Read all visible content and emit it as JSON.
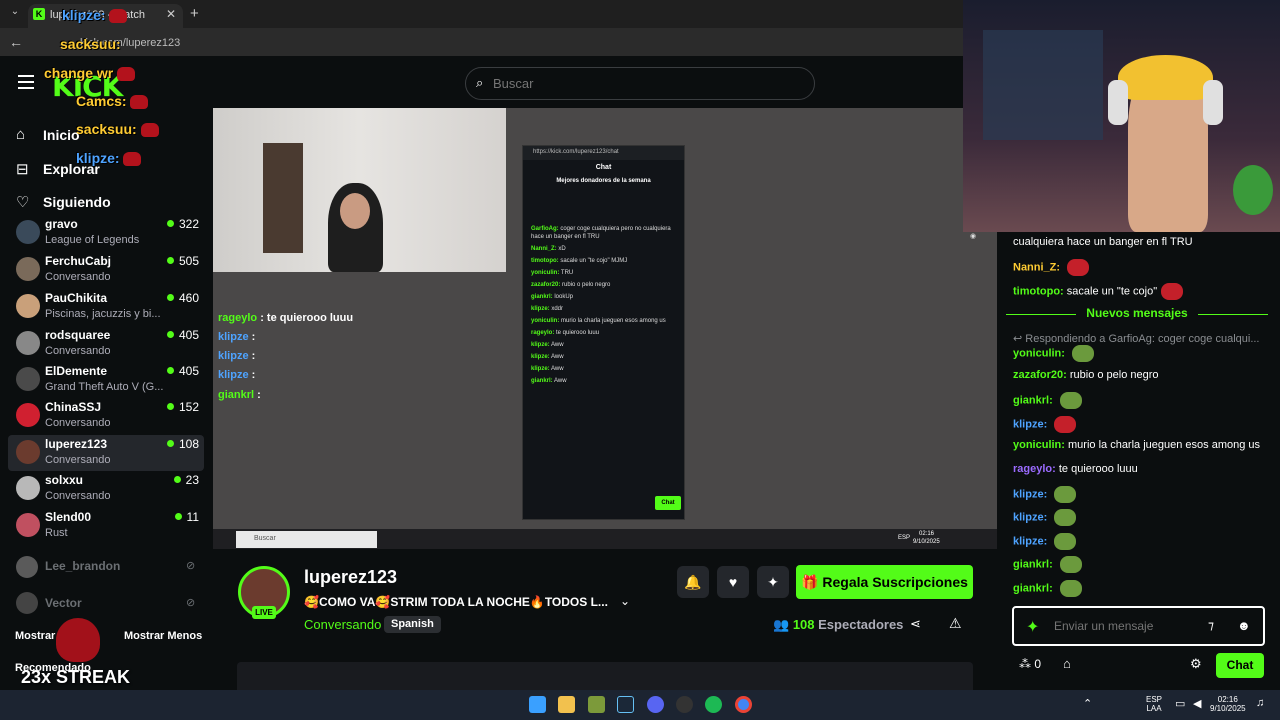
{
  "browser": {
    "tab_title": "luperez123 - Watch",
    "address": "kick.com/luperez123"
  },
  "overlay": {
    "lines": [
      {
        "user": "klipze:",
        "color": "#4ea3ff"
      },
      {
        "user": "sacksuu:",
        "color": "#ffcc33"
      },
      {
        "user": "change wr",
        "color": "#ffcc33"
      },
      {
        "user": "Camcs:",
        "color": "#ffcc33"
      },
      {
        "user": "sacksuu:",
        "color": "#ffcc33"
      },
      {
        "user": "klipze:",
        "color": "#4ea3ff"
      }
    ],
    "streak": "23x STREAK"
  },
  "header": {
    "logo": "KICK",
    "search_placeholder": "Buscar"
  },
  "sidebar": {
    "nav": [
      {
        "label": "Inicio",
        "icon": "home-icon"
      },
      {
        "label": "Explorar",
        "icon": "compass-icon"
      },
      {
        "label": "Siguiendo",
        "icon": "heart-icon"
      }
    ],
    "channels": [
      {
        "name": "gravo",
        "sub": "League of Legends",
        "count": "322",
        "avatar": "#3a4a5a"
      },
      {
        "name": "FerchuCabj",
        "sub": "Conversando",
        "count": "505",
        "avatar": "#7a6a5a"
      },
      {
        "name": "PauChikita",
        "sub": "Piscinas, jacuzzis y bi...",
        "count": "460",
        "avatar": "#c9a07a"
      },
      {
        "name": "rodsquaree",
        "sub": "Conversando",
        "count": "405",
        "avatar": "#888888"
      },
      {
        "name": "ElDemente",
        "sub": "Grand Theft Auto V (G...",
        "count": "405",
        "avatar": "#4a4a4a"
      },
      {
        "name": "ChinaSSJ",
        "sub": "Conversando",
        "count": "152",
        "avatar": "#d02030"
      },
      {
        "name": "luperez123",
        "sub": "Conversando",
        "count": "108",
        "avatar": "#6b3b2e"
      },
      {
        "name": "solxxu",
        "sub": "Conversando",
        "count": "23",
        "avatar": "#b8b8b8"
      },
      {
        "name": "Slend00",
        "sub": "Rust",
        "count": "11",
        "avatar": "#c05060"
      }
    ],
    "offline": [
      {
        "name": "Lee_brandon",
        "avatar": "#5a5a5a"
      },
      {
        "name": "Vector",
        "avatar": "#444444"
      }
    ],
    "show_more": "Mostrar",
    "show_less": "Mostrar Menos",
    "recommended": "Recomendado"
  },
  "player": {
    "chat_overlay": [
      {
        "user": "rageylo",
        "text": ": te quierooo luuu",
        "color": "#53fc18"
      },
      {
        "user": "klipze",
        "text": ":",
        "color": "#4ea3ff"
      },
      {
        "user": "klipze",
        "text": ":",
        "color": "#4ea3ff"
      },
      {
        "user": "klipze",
        "text": ":",
        "color": "#4ea3ff"
      },
      {
        "user": "giankrl",
        "text": ":",
        "color": "#53fc18"
      }
    ],
    "popup": {
      "url": "https://kick.com/luperez123/chat",
      "title": "Chat",
      "donors": "Mejores donadores de la semana",
      "lines": [
        {
          "user": "GarfioAg:",
          "text": "coger coge cualquiera pero no cualquiera hace un banger en fl TRU"
        },
        {
          "user": "Nanni_Z:",
          "text": "xD"
        },
        {
          "user": "timotopo:",
          "text": "sacale un \"te cojo\" MJMJ"
        },
        {
          "user": "yoniculin:",
          "text": "TRU"
        },
        {
          "user": "zazafor20:",
          "text": "rubio o pelo negro"
        },
        {
          "user": "giankrl:",
          "text": "lookUp"
        },
        {
          "user": "klipze:",
          "text": "xddr"
        },
        {
          "user": "yoniculin:",
          "text": "murio la charla jueguen esos among us"
        },
        {
          "user": "rageylo:",
          "text": "te quierooo luuu"
        },
        {
          "user": "klipze:",
          "text": "Aww"
        },
        {
          "user": "klipze:",
          "text": "Aww"
        },
        {
          "user": "klipze:",
          "text": "Aww"
        },
        {
          "user": "giankrl:",
          "text": "Aww"
        }
      ],
      "chat_btn": "Chat"
    },
    "taskbar_search": "Buscar",
    "clock": "02:16",
    "date": "9/10/2025",
    "lang": "ESP"
  },
  "stream": {
    "name": "luperez123",
    "title": "🥰COMO VA🥰STRIM TODA LA NOCHE🔥TODOS L...",
    "category": "Conversando",
    "language": "Spanish",
    "live": "LIVE",
    "subscribe": "Regala Suscripciones",
    "viewers_count": "108",
    "viewers_label": "Espectadores"
  },
  "chat": {
    "lines": [
      {
        "user": "",
        "text": "cualquiera hace un banger en fl TRU",
        "color": "#ffffff",
        "emote": ""
      },
      {
        "user": "Nanni_Z:",
        "text": "",
        "color": "#ffcc33",
        "emote": "red"
      },
      {
        "user": "timotopo:",
        "text": "sacale un \"te cojo\"",
        "color": "#53fc18",
        "emote": "red"
      }
    ],
    "new_messages": "Nuevos mensajes",
    "reply_hint": "Respondiendo a GarfioAg: coger coge cualqui...",
    "lines2": [
      {
        "user": "yoniculin:",
        "text": "",
        "color": "#53fc18",
        "emote": "pepe"
      },
      {
        "user": "zazafor20:",
        "text": "rubio o pelo negro",
        "color": "#53fc18",
        "emote": ""
      },
      {
        "user": "giankrl:",
        "text": "",
        "color": "#53fc18",
        "emote": "pepe"
      },
      {
        "user": "klipze:",
        "text": "",
        "color": "#4ea3ff",
        "emote": "red"
      },
      {
        "user": "yoniculin:",
        "text": "murio la charla jueguen esos among us",
        "color": "#53fc18",
        "emote": ""
      },
      {
        "user": "rageylo:",
        "text": "te quierooo luuu",
        "color": "#9b6bff",
        "emote": ""
      },
      {
        "user": "klipze:",
        "text": "",
        "color": "#4ea3ff",
        "emote": "pepe"
      },
      {
        "user": "klipze:",
        "text": "",
        "color": "#4ea3ff",
        "emote": "pepe"
      },
      {
        "user": "klipze:",
        "text": "",
        "color": "#4ea3ff",
        "emote": "pepe"
      },
      {
        "user": "giankrl:",
        "text": "",
        "color": "#53fc18",
        "emote": "pepe"
      },
      {
        "user": "giankrl:",
        "text": "",
        "color": "#53fc18",
        "emote": "pepe"
      }
    ],
    "input_placeholder": "Enviar un mensaje",
    "points": "0",
    "send": "Chat"
  },
  "taskbar": {
    "lang_top": "ESP",
    "lang_bottom": "LAA",
    "time": "02:16",
    "date": "9/10/2025"
  },
  "colors": {
    "accent": "#53fc18",
    "bg": "#0b0e0f"
  }
}
